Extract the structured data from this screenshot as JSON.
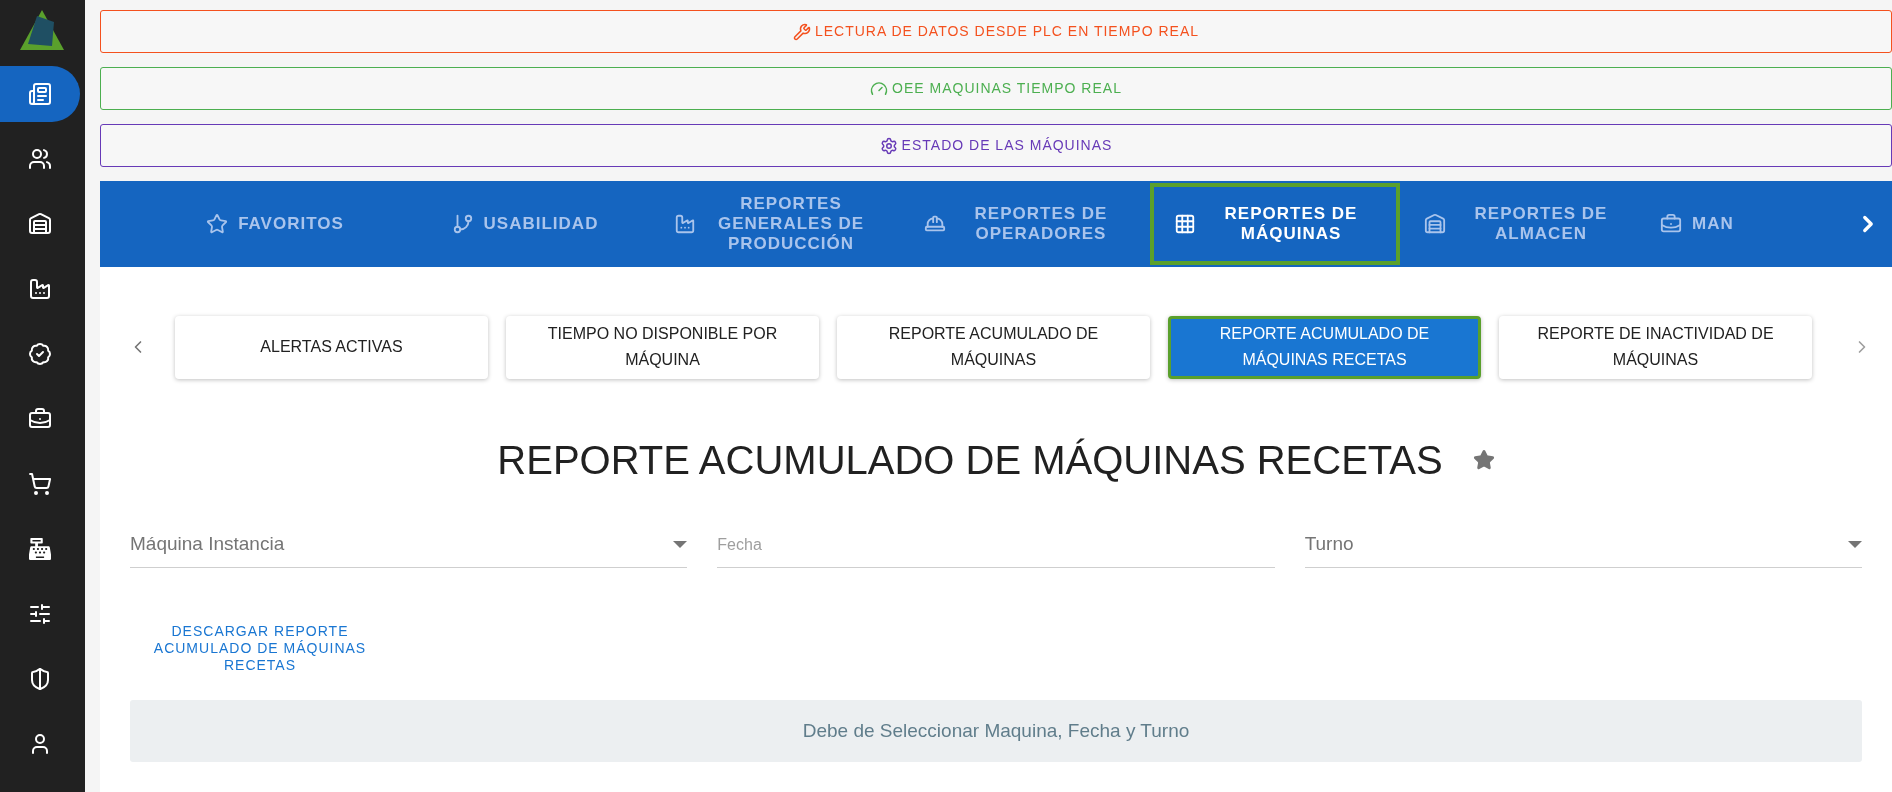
{
  "sidebar": {
    "items": [
      {
        "kind": "news",
        "selected": true
      },
      {
        "kind": "users",
        "selected": false
      },
      {
        "kind": "warehouse",
        "selected": false
      },
      {
        "kind": "factory",
        "selected": false
      },
      {
        "kind": "certificate",
        "selected": false
      },
      {
        "kind": "toolbox",
        "selected": false
      },
      {
        "kind": "cart",
        "selected": false
      },
      {
        "kind": "register",
        "selected": false
      },
      {
        "kind": "sliders",
        "selected": false
      },
      {
        "kind": "shield",
        "selected": false
      },
      {
        "kind": "user",
        "selected": false
      }
    ]
  },
  "banners": [
    {
      "kind": "plc",
      "label": "LECTURA DE DATOS DESDE PLC EN TIEMPO REAL",
      "color": "#f4511e"
    },
    {
      "kind": "gauge",
      "label": "OEE MAQUINAS TIEMPO REAL",
      "color": "#4caf50"
    },
    {
      "kind": "gear",
      "label": "ESTADO DE LAS MÁQUINAS",
      "color": "#673ab7"
    }
  ],
  "tabs": [
    {
      "kind": "star",
      "label": "FAVORITOS",
      "selected": false
    },
    {
      "kind": "branch",
      "label": "USABILIDAD",
      "selected": false
    },
    {
      "kind": "factory",
      "label": "REPORTES GENERALES DE PRODUCCIÓN",
      "selected": false
    },
    {
      "kind": "worker",
      "label": "REPORTES DE OPERADORES",
      "selected": false
    },
    {
      "kind": "grid",
      "label": "REPORTES DE MÁQUINAS",
      "selected": true
    },
    {
      "kind": "warehouse",
      "label": "REPORTES DE ALMACEN",
      "selected": false
    },
    {
      "kind": "toolbox",
      "label": "MAN",
      "selected": false
    }
  ],
  "subtabs": [
    {
      "label": "ALERTAS ACTIVAS",
      "selected": false
    },
    {
      "label": "TIEMPO NO DISPONIBLE POR MÁQUINA",
      "selected": false
    },
    {
      "label": "REPORTE ACUMULADO DE MÁQUINAS",
      "selected": false
    },
    {
      "label": "REPORTE ACUMULADO DE MÁQUINAS RECETAS",
      "selected": true
    },
    {
      "label": "REPORTE DE INACTIVIDAD DE MÁQUINAS",
      "selected": false
    }
  ],
  "title": "REPORTE ACUMULADO DE MÁQUINAS RECETAS",
  "filters": [
    {
      "kind": "select",
      "label": "Máquina Instancia"
    },
    {
      "kind": "date",
      "label": "Fecha"
    },
    {
      "kind": "select",
      "label": "Turno"
    }
  ],
  "download_link": "DESCARGAR REPORTE ACUMULADO DE MÁQUINAS RECETAS",
  "message": "Debe de Seleccionar Maquina, Fecha y Turno"
}
